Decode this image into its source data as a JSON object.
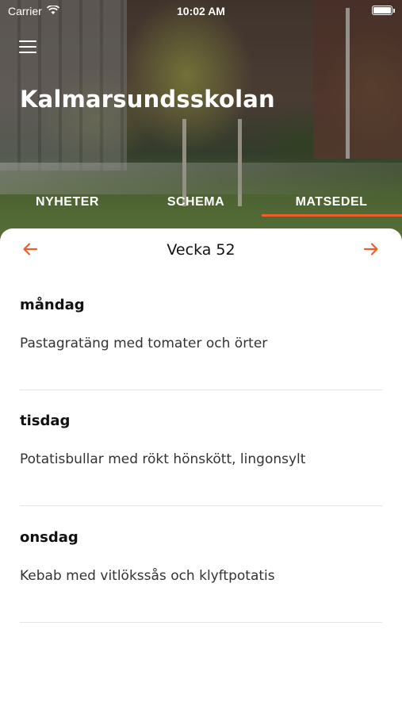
{
  "status_bar": {
    "carrier": "Carrier",
    "time": "10:02 AM"
  },
  "header": {
    "title": "Kalmarsundsskolan",
    "menu_icon": "hamburger-menu-icon"
  },
  "tabs": [
    {
      "label": "NYHETER",
      "active": false
    },
    {
      "label": "SCHEMA",
      "active": false
    },
    {
      "label": "MATSEDEL",
      "active": true
    }
  ],
  "week": {
    "label": "Vecka 52",
    "prev_icon": "arrow-left-icon",
    "next_icon": "arrow-right-icon"
  },
  "days": [
    {
      "name": "måndag",
      "meal": "Pastagratäng med tomater och örter"
    },
    {
      "name": "tisdag",
      "meal": "Potatisbullar med rökt hönskött, lingonsylt"
    },
    {
      "name": "onsdag",
      "meal": "Kebab med vitlökssås och klyftpotatis"
    }
  ],
  "colors": {
    "accent": "#e8612a",
    "text": "#111111",
    "divider": "#e4e4e4"
  }
}
